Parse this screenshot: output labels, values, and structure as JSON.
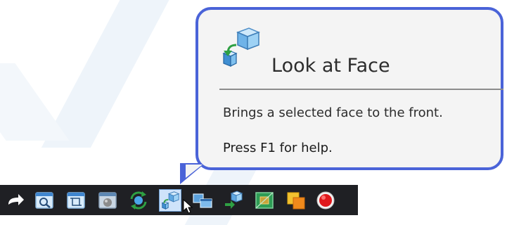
{
  "tooltip": {
    "title": "Look at Face",
    "description": "Brings a selected face to the front.",
    "help": "Press F1 for help.",
    "icon": "look-at-face-icon"
  },
  "toolbar": {
    "buttons": [
      {
        "name": "arrow-icon"
      },
      {
        "name": "zoom-window-icon"
      },
      {
        "name": "zoom-extents-icon"
      },
      {
        "name": "render-view-icon"
      },
      {
        "name": "rotate-view-icon"
      },
      {
        "name": "look-at-face-icon",
        "selected": true
      },
      {
        "name": "view-orientation-icon"
      },
      {
        "name": "move-face-icon"
      },
      {
        "name": "section-view-icon"
      },
      {
        "name": "overlap-icon"
      },
      {
        "name": "record-icon"
      }
    ]
  },
  "colors": {
    "tooltip_border": "#4a63d8",
    "tooltip_background": "#f4f4f4",
    "toolbar_background": "#1f2024"
  }
}
